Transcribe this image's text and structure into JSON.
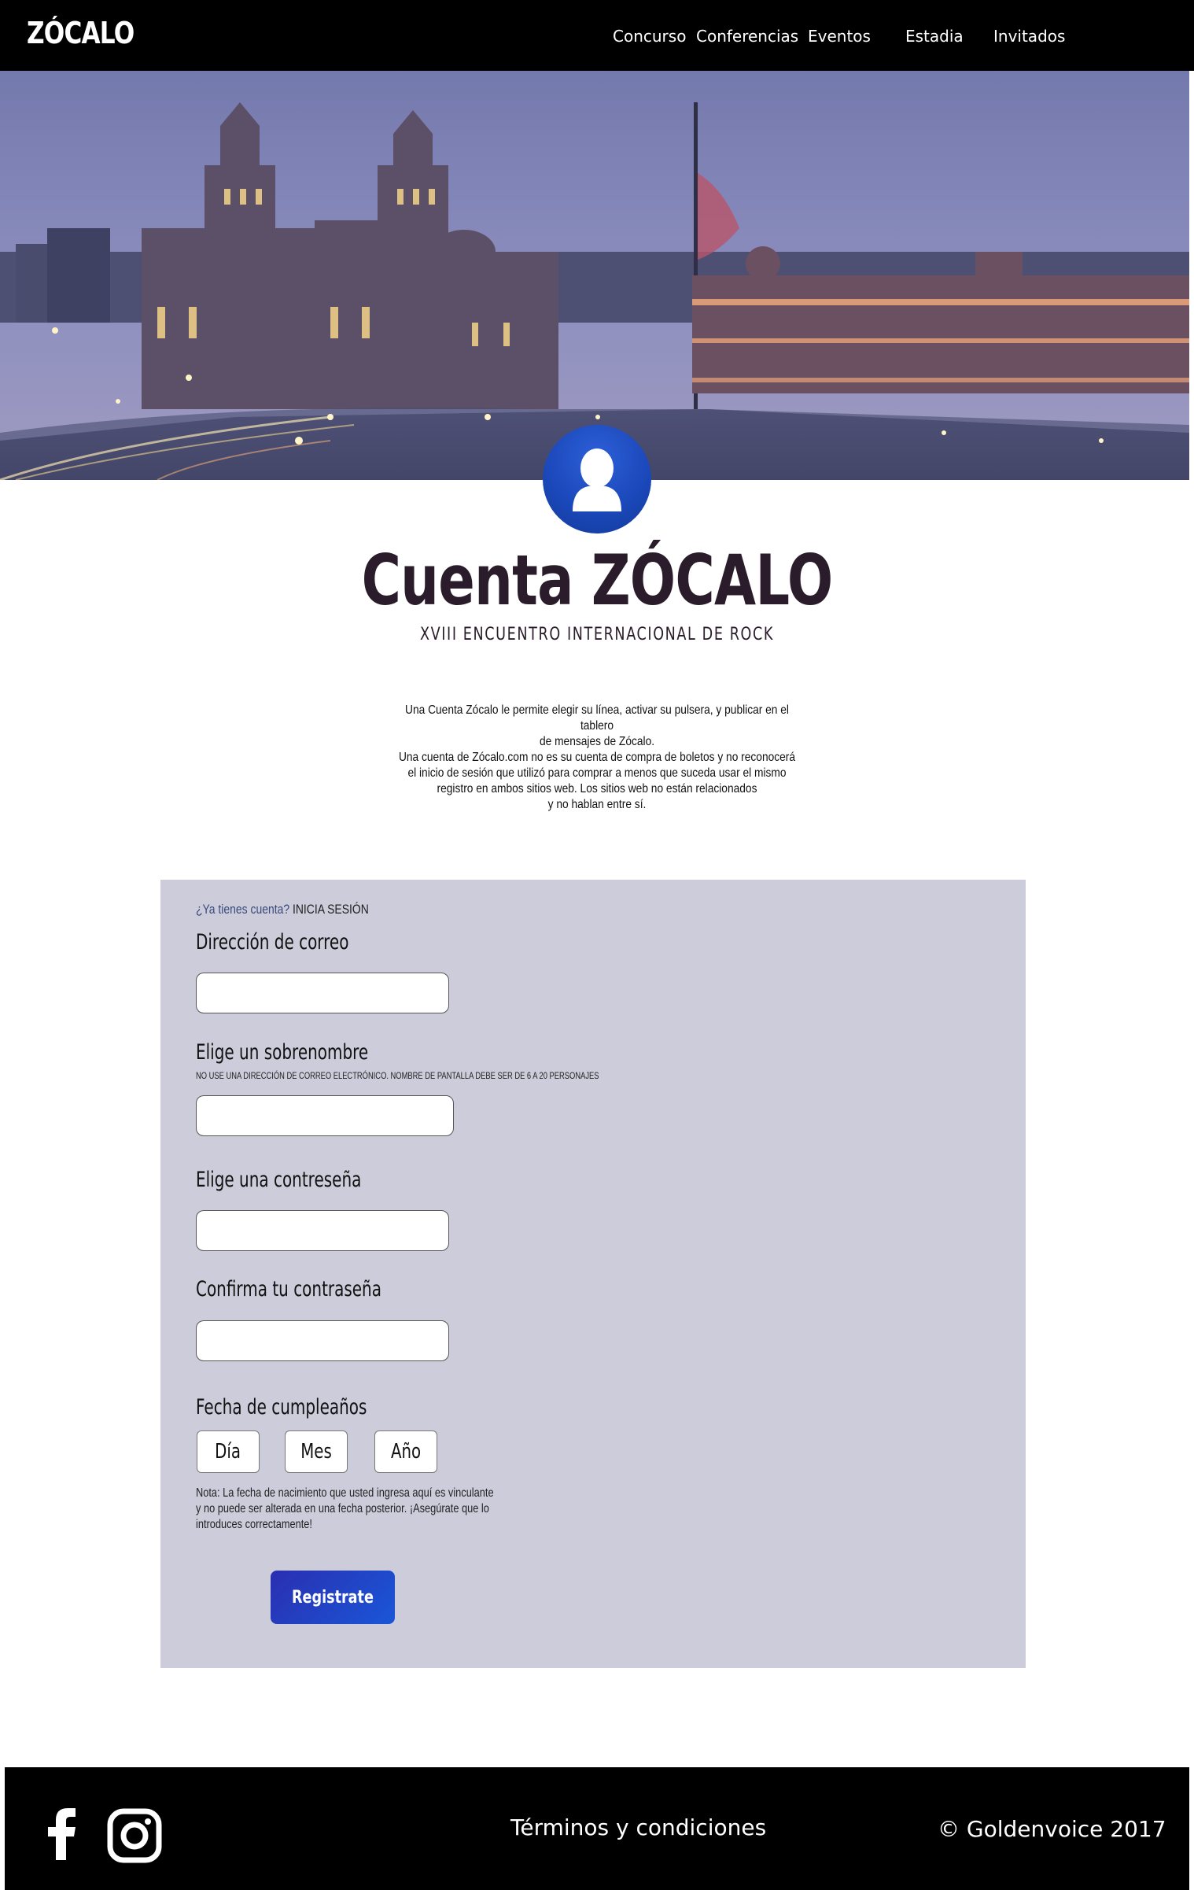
{
  "brand": {
    "logo": "ZÓCALO"
  },
  "nav": {
    "items": [
      {
        "label": "Concurso"
      },
      {
        "label": "Conferencias"
      },
      {
        "label": "Eventos"
      },
      {
        "label": "Estadia"
      },
      {
        "label": "Invitados"
      }
    ]
  },
  "header": {
    "title": "Cuenta ZÓCALO",
    "subtitle": "XVIII ENCUENTRO INTERNACIONAL DE ROCK"
  },
  "intro": {
    "p1_lines": [
      "Una Cuenta Zócalo le permite elegir su línea, activar su pulsera, y publicar en el tablero",
      "de mensajes de Zócalo."
    ],
    "p2_lines": [
      "Una cuenta de Zócalo.com no es su cuenta de compra de boletos y no reconocerá",
      "el inicio de sesión que utilizó para comprar a menos que suceda usar el mismo",
      "registro en ambos sitios web. Los sitios web no están relacionados",
      "y no hablan entre sí."
    ]
  },
  "form": {
    "login_question": "¿Ya tienes cuenta?",
    "login_action": "INICIA SESIÓN",
    "email": {
      "label": "Dirección de correo",
      "value": "",
      "placeholder": ""
    },
    "nickname": {
      "label": "Elige un sobrenombre",
      "hint": "NO USE UNA DIRECCIÓN DE CORREO ELECTRÓNICO. NOMBRE DE PANTALLA DEBE SER DE 6 A 20 PERSONAJES",
      "value": "",
      "placeholder": ""
    },
    "password": {
      "label": "Elige una contreseña",
      "value": "",
      "placeholder": ""
    },
    "confirm_password": {
      "label": "Confirma tu contraseña",
      "value": "",
      "placeholder": ""
    },
    "birthday": {
      "label": "Fecha de cumpleaños",
      "day": "Día",
      "month": "Mes",
      "year": "Año"
    },
    "note_lines": [
      "Nota: La fecha de nacimiento que usted ingresa aquí es vinculante",
      "y no puede ser alterada en una fecha posterior. ¡Asegúrate que lo",
      "introduces correctamente!"
    ],
    "submit_label": "Registrate"
  },
  "footer": {
    "terms": "Términos y condiciones",
    "copyright": "© Goldenvoice 2017",
    "social_icons": [
      "facebook-icon",
      "instagram-icon"
    ]
  },
  "colors": {
    "nav_bg": "#000000",
    "panel_bg": "#ccccdb",
    "accent": "#1f4fc9",
    "title": "#2a1c2a"
  }
}
